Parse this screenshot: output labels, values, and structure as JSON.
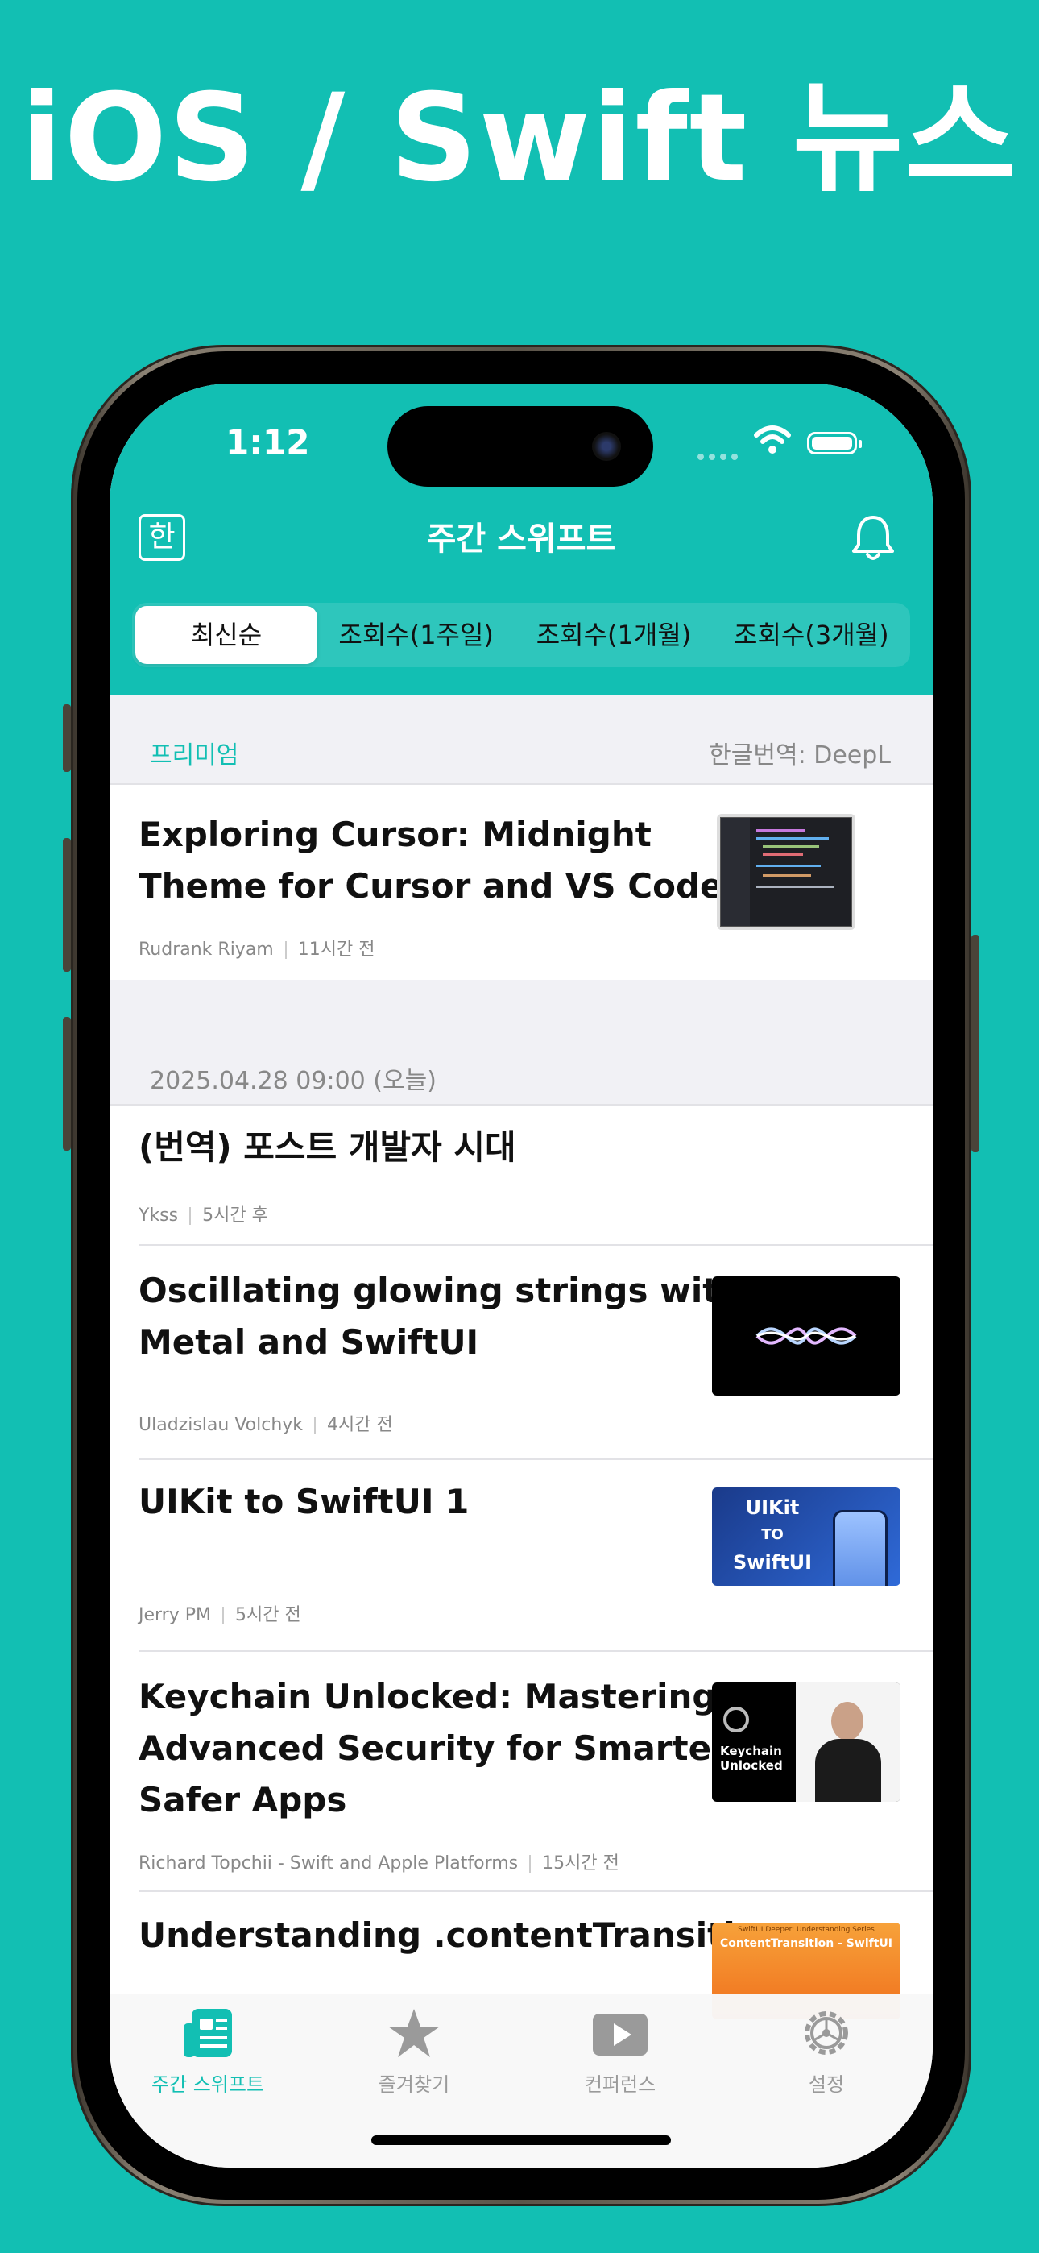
{
  "hero": {
    "title": "iOS / Swift 뉴스"
  },
  "status_bar": {
    "time": "1:12"
  },
  "header": {
    "lang_button": "한",
    "title": "주간 스위프트"
  },
  "segments": [
    "최신순",
    "조회수(1주일)",
    "조회수(1개월)",
    "조회수(3개월)"
  ],
  "premium": {
    "label": "프리미엄",
    "translation": "한글번역: DeepL",
    "article": {
      "title_line1": "Exploring Cursor: Midnight",
      "title_line2": "Theme for Cursor and VS Code",
      "author": "Rudrank Riyam",
      "time": "11시간 전"
    }
  },
  "date_section": {
    "label": "2025.04.28 09:00 (오늘)"
  },
  "articles": [
    {
      "title_line1": "(번역) 포스트 개발자 시대",
      "title_line2": "",
      "title_line3": "",
      "author": "Ykss",
      "time": "5시간 후"
    },
    {
      "title_line1": "Oscillating glowing strings with",
      "title_line2": "Metal and SwiftUI",
      "title_line3": "",
      "author": "Uladzislau Volchyk",
      "time": "4시간 전"
    },
    {
      "title_line1": "UIKit to SwiftUI 1",
      "title_line2": "",
      "title_line3": "",
      "author": "Jerry PM",
      "time": "5시간 전",
      "thumb_text": [
        "UIKit",
        "TO",
        "SwiftUI"
      ]
    },
    {
      "title_line1": "Keychain Unlocked: Mastering",
      "title_line2": "Advanced Security for Smarter,",
      "title_line3": "Safer Apps",
      "author": "Richard Topchii - Swift and Apple Platforms",
      "time": "15시간 전",
      "thumb_text": [
        "Keychain",
        "Unlocked"
      ]
    },
    {
      "title_line1": "Understanding .contentTransitio",
      "title_line2": "",
      "title_line3": "",
      "author": "",
      "time": "",
      "thumb_text": [
        "SwiftUI Deeper: Understanding Series",
        "ContentTransition - SwiftUI"
      ]
    }
  ],
  "tabbar": {
    "tabs": [
      {
        "label": "주간 스위프트",
        "icon": "newspaper-icon",
        "active": true
      },
      {
        "label": "즐겨찾기",
        "icon": "star-icon",
        "active": false
      },
      {
        "label": "컨퍼런스",
        "icon": "play-icon",
        "active": false
      },
      {
        "label": "설정",
        "icon": "gear-icon",
        "active": false
      }
    ]
  },
  "colors": {
    "accent": "#12bfb3",
    "background": "#12bfb3",
    "section_gray": "#f1f1f5"
  }
}
